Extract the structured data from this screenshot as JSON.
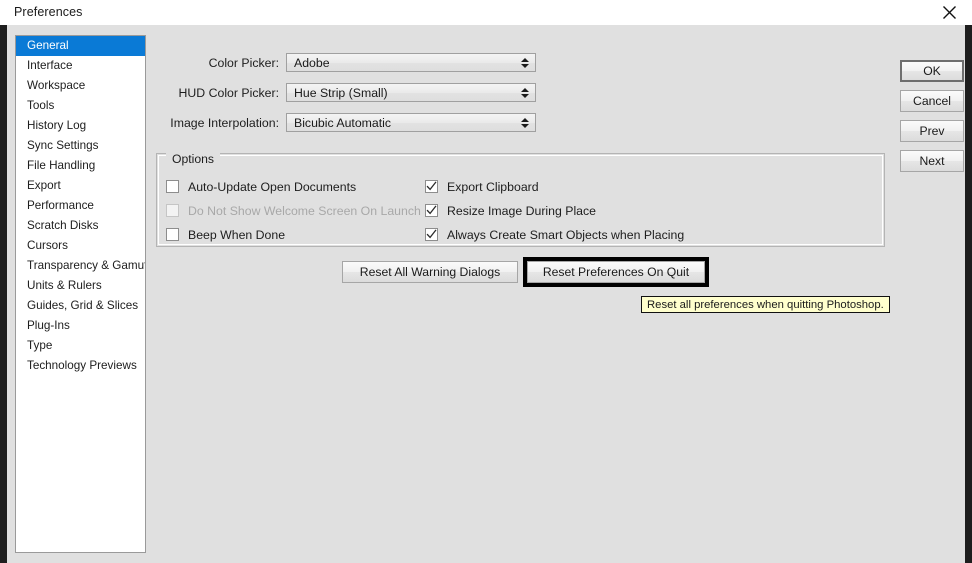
{
  "window": {
    "title": "Preferences",
    "close_icon": "close-icon"
  },
  "sidebar": {
    "items": [
      {
        "label": "General",
        "selected": true
      },
      {
        "label": "Interface",
        "selected": false
      },
      {
        "label": "Workspace",
        "selected": false
      },
      {
        "label": "Tools",
        "selected": false
      },
      {
        "label": "History Log",
        "selected": false
      },
      {
        "label": "Sync Settings",
        "selected": false
      },
      {
        "label": "File Handling",
        "selected": false
      },
      {
        "label": "Export",
        "selected": false
      },
      {
        "label": "Performance",
        "selected": false
      },
      {
        "label": "Scratch Disks",
        "selected": false
      },
      {
        "label": "Cursors",
        "selected": false
      },
      {
        "label": "Transparency & Gamut",
        "selected": false
      },
      {
        "label": "Units & Rulers",
        "selected": false
      },
      {
        "label": "Guides, Grid & Slices",
        "selected": false
      },
      {
        "label": "Plug-Ins",
        "selected": false
      },
      {
        "label": "Type",
        "selected": false
      },
      {
        "label": "Technology Previews",
        "selected": false
      }
    ]
  },
  "fields": [
    {
      "label": "Color Picker:",
      "value": "Adobe"
    },
    {
      "label": "HUD Color Picker:",
      "value": "Hue Strip (Small)"
    },
    {
      "label": "Image Interpolation:",
      "value": "Bicubic Automatic"
    }
  ],
  "options": {
    "legend": "Options",
    "left_column": [
      {
        "label": "Auto-Update Open Documents",
        "checked": false,
        "disabled": false
      },
      {
        "label": "Do Not Show Welcome Screen On Launch",
        "checked": false,
        "disabled": true
      },
      {
        "label": "Beep When Done",
        "checked": false,
        "disabled": false
      }
    ],
    "right_column": [
      {
        "label": "Export Clipboard",
        "checked": true,
        "disabled": false
      },
      {
        "label": "Resize Image During Place",
        "checked": true,
        "disabled": false
      },
      {
        "label": "Always Create Smart Objects when Placing",
        "checked": true,
        "disabled": false
      }
    ]
  },
  "buttons": {
    "reset_warnings": "Reset All Warning Dialogs",
    "reset_prefs_on_quit": "Reset Preferences On Quit",
    "ok": "OK",
    "cancel": "Cancel",
    "prev": "Prev",
    "next": "Next"
  },
  "tooltip": {
    "text": "Reset all preferences when quitting Photoshop."
  },
  "colors": {
    "selection_blue": "#0a7ad6",
    "dialog_bg": "#e0e0e0",
    "titlebar_bg": "#ffffff",
    "tooltip_bg": "#ffffcd",
    "focus_ring": "#000000"
  }
}
